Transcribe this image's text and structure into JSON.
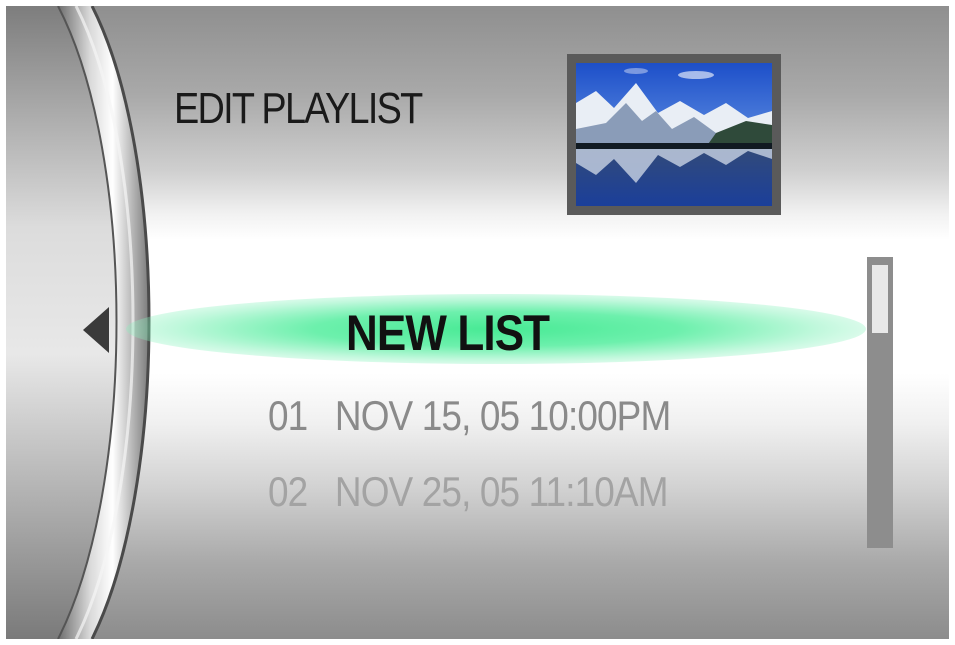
{
  "screen": {
    "title": "EDIT PLAYLIST",
    "thumbnail_icon": "mountain-lake-photo-thumbnail",
    "back_icon": "left-triangle-arrow-icon"
  },
  "playlist": {
    "selected_item": "NEW LIST",
    "highlight_color": "#2ee68a",
    "items": [
      {
        "number": "01",
        "label": "NOV 15, 05 10:00PM"
      },
      {
        "number": "02",
        "label": "NOV 25, 05 11:10AM"
      }
    ]
  },
  "scrollbar": {
    "track_color": "#8d8d8d",
    "thumb_color": "#e8e8e8"
  }
}
